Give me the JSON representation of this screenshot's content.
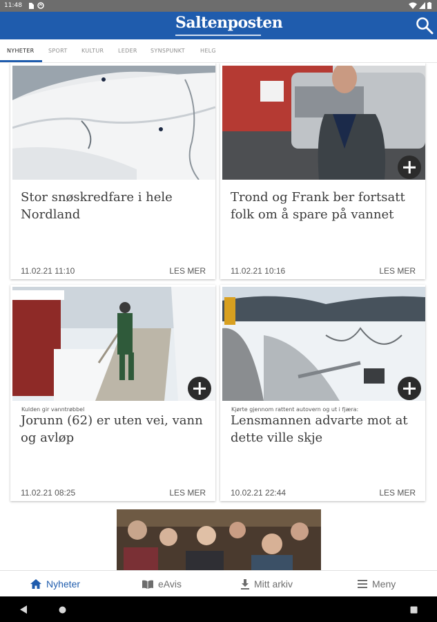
{
  "status_bar": {
    "time": "11:48"
  },
  "app": {
    "title": "Saltenposten"
  },
  "tabs": [
    {
      "label": "NYHETER"
    },
    {
      "label": "SPORT"
    },
    {
      "label": "KULTUR"
    },
    {
      "label": "LEDER"
    },
    {
      "label": "SYNSPUNKT"
    },
    {
      "label": "HELG"
    }
  ],
  "articles": [
    {
      "kicker": "",
      "headline": "Stor snøskredfare i hele Nordland",
      "date": "11.02.21 11:10",
      "more": "LES MER"
    },
    {
      "kicker": "",
      "headline": "Trond og Frank ber fortsatt folk om å spare på vannet",
      "date": "11.02.21 10:16",
      "more": "LES MER"
    },
    {
      "kicker": "Kulden gir vanntrøbbel",
      "headline": "Jorunn (62) er uten vei, vann og avløp",
      "date": "11.02.21 08:25",
      "more": "LES MER"
    },
    {
      "kicker": "Kjørte gjennom rattent autovern og ut i fjæra:",
      "headline": "Lensmannen advarte mot at dette ville skje",
      "date": "10.02.21 22:44",
      "more": "LES MER"
    }
  ],
  "bottom_nav": [
    {
      "label": "Nyheter",
      "icon": "home-icon"
    },
    {
      "label": "eAvis",
      "icon": "book-icon"
    },
    {
      "label": "Mitt arkiv",
      "icon": "download-icon"
    },
    {
      "label": "Meny",
      "icon": "menu-icon"
    }
  ],
  "colors": {
    "brand": "#1f5cad",
    "status_bar": "#6d6d6d"
  }
}
